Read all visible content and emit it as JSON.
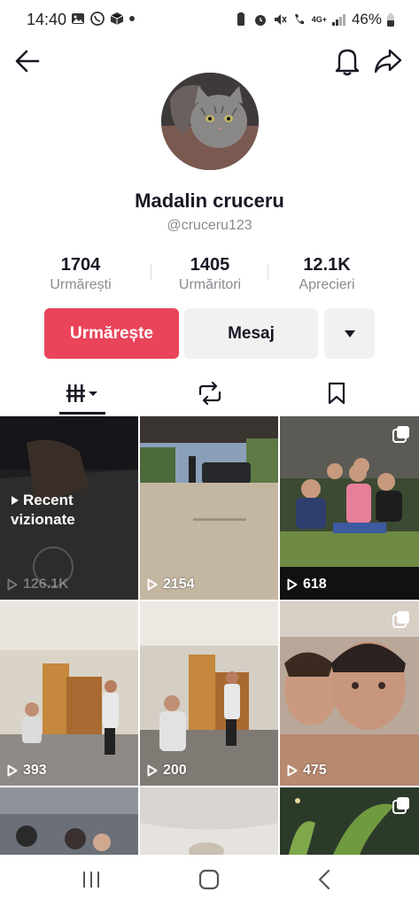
{
  "status_bar": {
    "time": "14:40",
    "battery": "46%",
    "network": "4G+"
  },
  "profile": {
    "name": "Madalin cruceru",
    "handle": "@cruceru123"
  },
  "stats": [
    {
      "value": "1704",
      "label": "Urmărești"
    },
    {
      "value": "1405",
      "label": "Urmăritori"
    },
    {
      "value": "12.1K",
      "label": "Aprecieri"
    }
  ],
  "actions": {
    "follow": "Urmărește",
    "message": "Mesaj"
  },
  "videos": [
    {
      "views": "126.1K",
      "overlay": "Recent\nvizionate",
      "overlay_line1": "Recent",
      "overlay_line2": "vizionate"
    },
    {
      "views": "2154"
    },
    {
      "views": "618"
    },
    {
      "views": "393"
    },
    {
      "views": "200"
    },
    {
      "views": "475"
    }
  ],
  "colors": {
    "accent": "#e9445a",
    "secondary_button": "#f1f1f2",
    "muted_text": "#8a8b91"
  },
  "icons": [
    "back-arrow-icon",
    "bell-icon",
    "share-icon",
    "grid-icon",
    "repost-icon",
    "bookmark-icon",
    "chevron-down-icon",
    "play-icon",
    "multi-photo-icon"
  ]
}
